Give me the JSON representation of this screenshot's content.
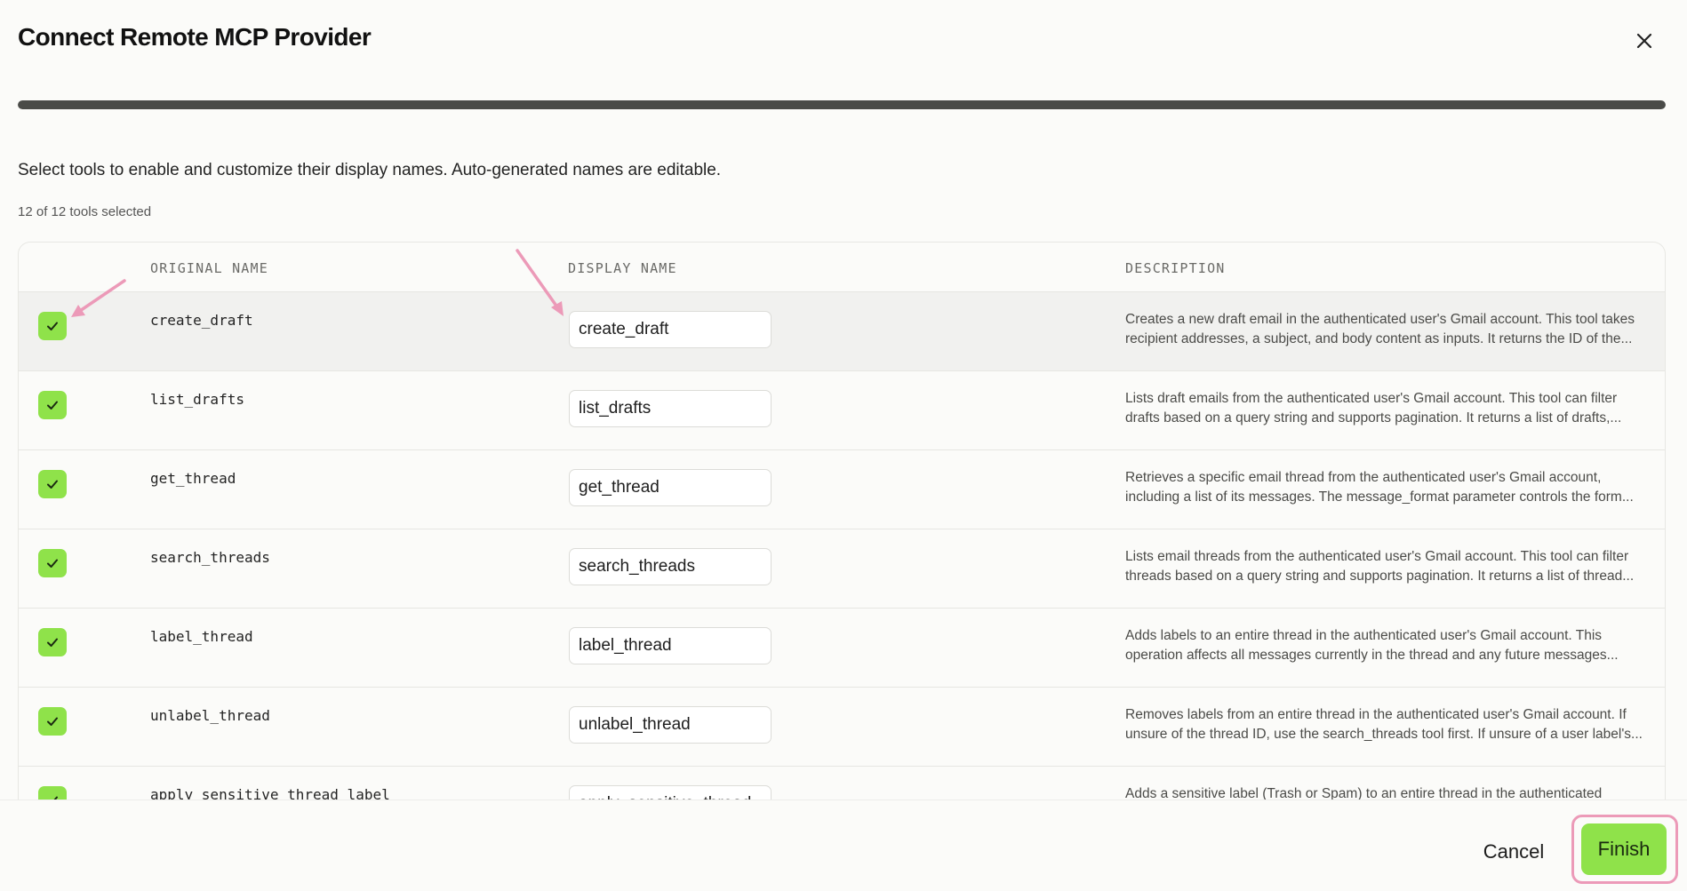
{
  "dialog": {
    "title": "Connect Remote MCP Provider",
    "instructions": "Select tools to enable and customize their display names. Auto-generated names are editable.",
    "selection_count": "12 of 12 tools selected",
    "progress_fraction": 1.0
  },
  "table": {
    "headers": {
      "original_name": "ORIGINAL NAME",
      "display_name": "DISPLAY NAME",
      "description": "DESCRIPTION"
    },
    "rows": [
      {
        "checked": true,
        "original_name": "create_draft",
        "display_name": "create_draft",
        "description": "Creates a new draft email in the authenticated user's Gmail account. This tool takes recipient addresses, a subject, and body content as inputs. It returns the ID of the..."
      },
      {
        "checked": true,
        "original_name": "list_drafts",
        "display_name": "list_drafts",
        "description": "Lists draft emails from the authenticated user's Gmail account. This tool can filter drafts based on a query string and supports pagination. It returns a list of drafts,..."
      },
      {
        "checked": true,
        "original_name": "get_thread",
        "display_name": "get_thread",
        "description": "Retrieves a specific email thread from the authenticated user's Gmail account, including a list of its messages. The message_format parameter controls the form..."
      },
      {
        "checked": true,
        "original_name": "search_threads",
        "display_name": "search_threads",
        "description": "Lists email threads from the authenticated user's Gmail account. This tool can filter threads based on a query string and supports pagination. It returns a list of thread..."
      },
      {
        "checked": true,
        "original_name": "label_thread",
        "display_name": "label_thread",
        "description": "Adds labels to an entire thread in the authenticated user's Gmail account. This operation affects all messages currently in the thread and any future messages..."
      },
      {
        "checked": true,
        "original_name": "unlabel_thread",
        "display_name": "unlabel_thread",
        "description": "Removes labels from an entire thread in the authenticated user's Gmail account. If unsure of the thread ID, use the search_threads tool first. If unsure of a user label's..."
      },
      {
        "checked": true,
        "original_name": "apply_sensitive_thread_label",
        "display_name": "apply_sensitive_thread_label",
        "description": "Adds a sensitive label (Trash or Spam) to an entire thread in the authenticated"
      }
    ]
  },
  "footer": {
    "cancel_label": "Cancel",
    "finish_label": "Finish"
  },
  "colors": {
    "accent_green": "#8fe24a",
    "annotation_pink": "#ec9ab8",
    "progress_dark": "#4a4b48"
  },
  "icons": {
    "close": "close-icon",
    "check": "checkmark-icon"
  }
}
